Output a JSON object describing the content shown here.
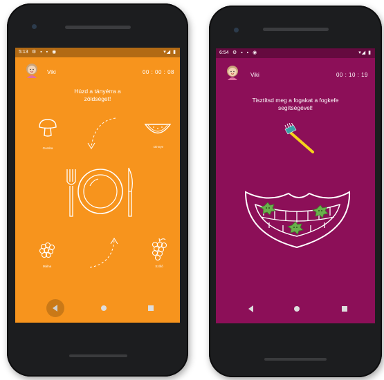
{
  "left_phone": {
    "status": {
      "time": "5:13",
      "icons": "⚙ ▪ ▪ ◉",
      "system": "▾◢ ▮"
    },
    "user": {
      "name": "Viki"
    },
    "timer": "00 : 00 : 08",
    "instruction_line1": "Húzd a tányérra a",
    "instruction_line2": "zöldséget!",
    "foods": [
      {
        "label": "Gomba",
        "icon": "mushroom-icon"
      },
      {
        "label": "Dinnye",
        "icon": "watermelon-icon"
      },
      {
        "label": "Málna",
        "icon": "raspberry-icon"
      },
      {
        "label": "Szőlő",
        "icon": "grapes-icon"
      }
    ],
    "center_icon": "plate-fork-knife-icon",
    "nav": [
      "back-icon",
      "home-icon",
      "recents-icon"
    ]
  },
  "right_phone": {
    "status": {
      "time": "6:54",
      "icons": "⚙ ▪ ▪ ◉",
      "system": "▾◢ ▮"
    },
    "user": {
      "name": "Viki"
    },
    "timer": "00 : 10 : 19",
    "instruction_line1": "Tisztítsd meg a fogakat a fogkefe",
    "instruction_line2": "segítségével!",
    "tools": [
      "toothbrush-icon",
      "mouth-teeth-icon",
      "germ-icon"
    ],
    "nav": [
      "back-icon",
      "home-icon",
      "recents-icon"
    ]
  },
  "colors": {
    "orange_bg": "#f7941d",
    "magenta_bg": "#8c0f58",
    "germ_green": "#6ab04c",
    "brush_yellow": "#f5d21b"
  }
}
